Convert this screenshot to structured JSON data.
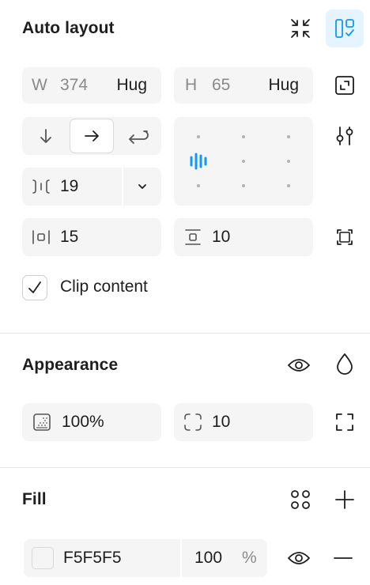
{
  "auto_layout": {
    "title": "Auto layout",
    "width": {
      "prefix": "W",
      "value": "374",
      "mode": "Hug"
    },
    "height": {
      "prefix": "H",
      "value": "65",
      "mode": "Hug"
    },
    "gap": {
      "value": "19"
    },
    "padding_horizontal": {
      "value": "15"
    },
    "padding_vertical": {
      "value": "10"
    },
    "clip_content": {
      "label": "Clip content",
      "checked": true
    }
  },
  "appearance": {
    "title": "Appearance",
    "opacity": {
      "value": "100%"
    },
    "corner_radius": {
      "value": "10"
    }
  },
  "fill": {
    "title": "Fill",
    "hex": "F5F5F5",
    "opacity": "100",
    "percent_sign": "%"
  },
  "colors": {
    "accent": "#0d99ff",
    "selected_bg": "#e5f4ff",
    "field_bg": "#f5f5f5",
    "swatch": "#f5f5f5"
  }
}
